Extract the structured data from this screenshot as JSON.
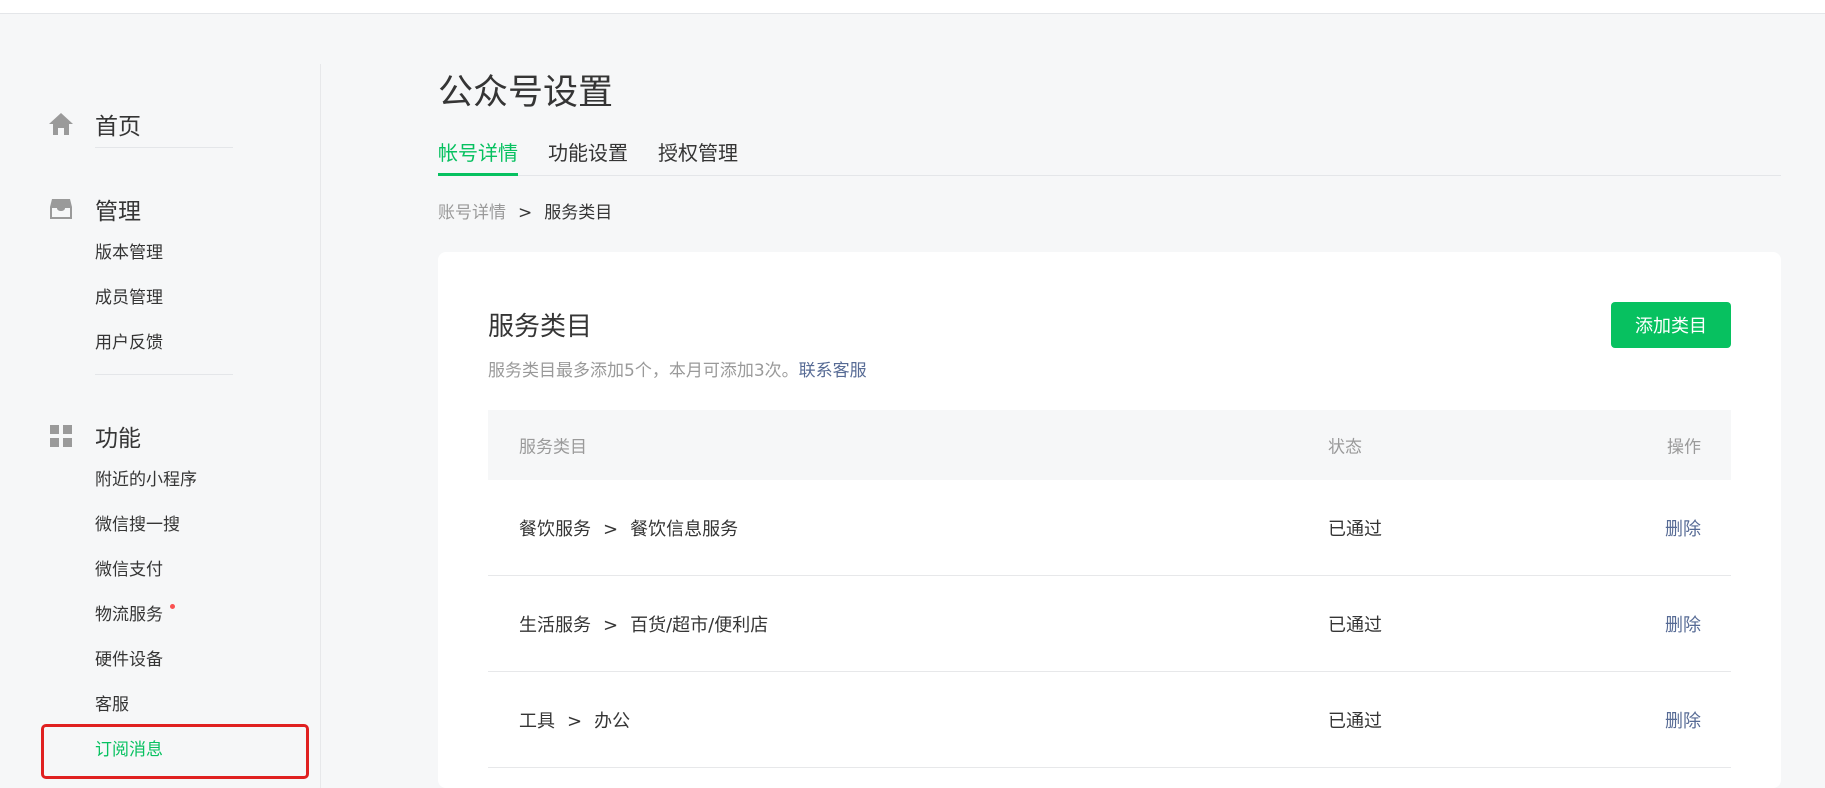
{
  "sidebar": {
    "home": {
      "label": "首页",
      "icon": "home-icon"
    },
    "manage": {
      "label": "管理",
      "icon": "inbox-icon",
      "items": [
        "版本管理",
        "成员管理",
        "用户反馈"
      ]
    },
    "features": {
      "label": "功能",
      "icon": "grid-icon",
      "items": [
        "附近的小程序",
        "微信搜一搜",
        "微信支付",
        "物流服务",
        "硬件设备",
        "客服",
        "订阅消息"
      ],
      "active_item": "订阅消息",
      "badge_item": "物流服务"
    }
  },
  "page": {
    "title": "公众号设置",
    "tabs": [
      {
        "label": "帐号详情",
        "active": true
      },
      {
        "label": "功能设置",
        "active": false
      },
      {
        "label": "授权管理",
        "active": false
      }
    ],
    "breadcrumb": {
      "parent": "账号详情",
      "separator": ">",
      "current": "服务类目"
    }
  },
  "card": {
    "title": "服务类目",
    "desc": "服务类目最多添加5个，本月可添加3次。",
    "desc_link": "联系客服",
    "add_button": "添加类目",
    "table": {
      "headers": {
        "category": "服务类目",
        "status": "状态",
        "op": "操作"
      },
      "rows": [
        {
          "primary": "餐饮服务",
          "arrow": ">",
          "secondary": "餐饮信息服务",
          "status": "已通过",
          "op": "删除"
        },
        {
          "primary": "生活服务",
          "arrow": ">",
          "secondary": "百货/超市/便利店",
          "status": "已通过",
          "op": "删除"
        },
        {
          "primary": "工具",
          "arrow": ">",
          "secondary": "办公",
          "status": "已通过",
          "op": "删除"
        }
      ]
    }
  },
  "colors": {
    "accent": "#07c160",
    "link": "#576b95",
    "highlight": "#e02020",
    "badge": "#fa5151"
  }
}
